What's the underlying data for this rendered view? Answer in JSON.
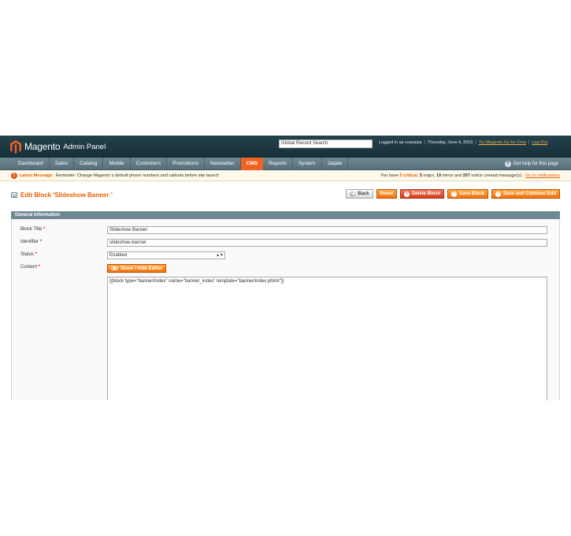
{
  "header": {
    "brand": "Magento",
    "brand_sub": "Admin Panel",
    "search_value": "Global Record Search",
    "logged_in": "Logged in as cozyasia",
    "date": "Thursday, June 4, 2015",
    "try_link": "Try Magento Go for Free",
    "logout": "Log Out",
    "sep": "|"
  },
  "nav": {
    "items": [
      {
        "label": "Dashboard"
      },
      {
        "label": "Sales"
      },
      {
        "label": "Catalog"
      },
      {
        "label": "Mobile"
      },
      {
        "label": "Customers"
      },
      {
        "label": "Promotions"
      },
      {
        "label": "Newsletter"
      },
      {
        "label": "CMS"
      },
      {
        "label": "Reports"
      },
      {
        "label": "System"
      },
      {
        "label": "Jatjale"
      }
    ],
    "active": "CMS",
    "help": "Get help for this page"
  },
  "messages": {
    "latest_label": "Latest Message:",
    "latest_text": "Reminder: Change Magento`s default phone numbers and callouts before site launch",
    "count_prefix": "You have",
    "critical": "5 critical",
    "major": "5",
    "major_label": "major,",
    "minor": "19",
    "minor_label": "minor and",
    "notice": "207",
    "notice_label": "notice unread message(s).",
    "link": "Go to notifications"
  },
  "page": {
    "title": "Edit Block 'Slideshow Banner '",
    "buttons": {
      "back": "Back",
      "reset": "Reset",
      "delete": "Delete Block",
      "save": "Save Block",
      "save_continue": "Save and Continue Edit"
    }
  },
  "form": {
    "section_title": "General Information",
    "required_mark": "*",
    "block_title_label": "Block Title",
    "block_title_value": "Slideshow Banner",
    "identifier_label": "Identifier",
    "identifier_value": "slideshow-banner",
    "status_label": "Status",
    "status_value": "Enabled",
    "content_label": "Content",
    "editor_toggle": "Show / Hide Editor",
    "content_value": "{{block type=\"banner/index\" name=\"banner_index\" template=\"banner/index.phtml\"}}"
  },
  "colors": {
    "accent": "#f26322",
    "header_bg": "#1f3a45",
    "nav_bg": "#647e88",
    "title": "#eb5e00"
  }
}
